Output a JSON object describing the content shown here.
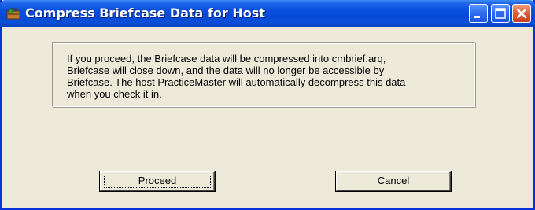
{
  "window": {
    "title": "Compress Briefcase Data for Host",
    "icon": "briefcase-app-icon"
  },
  "titlebar_buttons": {
    "minimize_icon": "minimize-icon",
    "maximize_icon": "maximize-icon",
    "close_icon": "close-icon"
  },
  "message": {
    "text": "If you proceed, the Briefcase data will be compressed into cmbrief.arq,\nBriefcase will close down, and the data will no longer be accessible by\nBriefcase.  The host PracticeMaster will automatically decompress this data\nwhen you check it in."
  },
  "buttons": {
    "proceed_label": "Proceed",
    "cancel_label": "Cancel"
  },
  "colors": {
    "titlebar": "#0a52de",
    "window_face": "#ece9d8",
    "close_button": "#e0603a"
  }
}
